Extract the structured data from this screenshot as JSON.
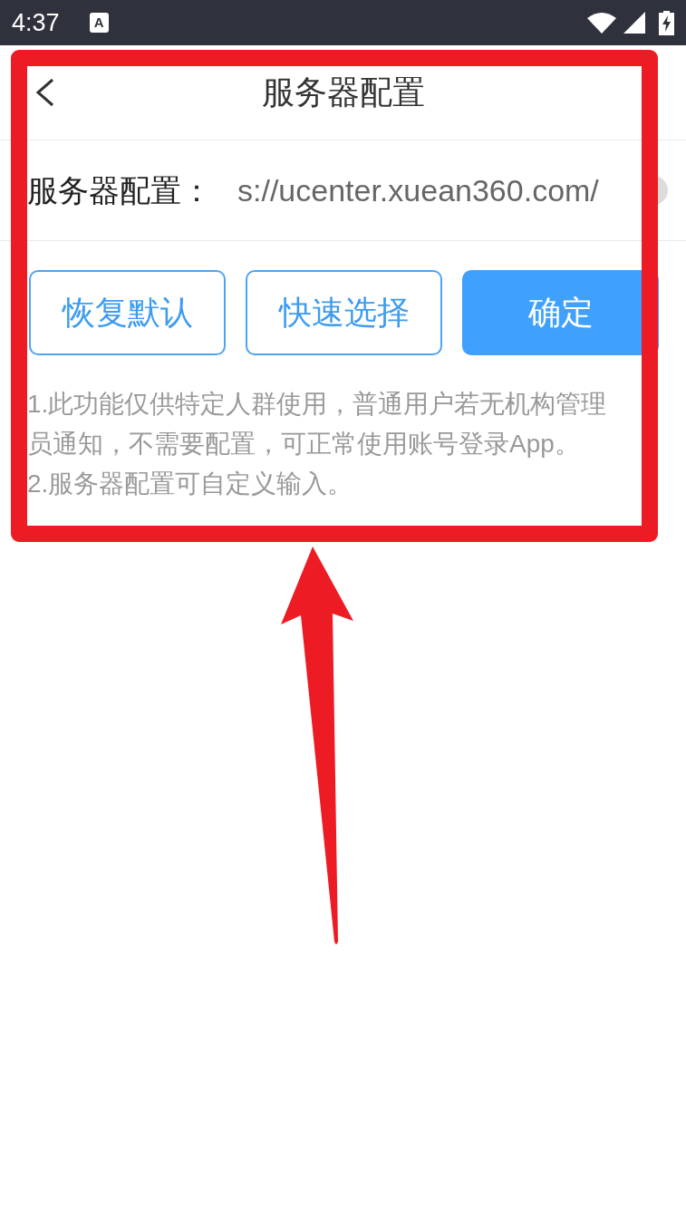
{
  "status_bar": {
    "time": "4:37",
    "input_method": "A"
  },
  "header": {
    "title": "服务器配置"
  },
  "server_field": {
    "label": "服务器配置：",
    "value": "s://ucenter.xuean360.com/"
  },
  "buttons": [
    {
      "label": "恢复默认",
      "kind": "outline"
    },
    {
      "label": "快速选择",
      "kind": "outline"
    },
    {
      "label": "确定",
      "kind": "primary"
    }
  ],
  "notes": [
    "1.此功能仅供特定人群使用，普通用户若无机构管理员通知，不需要配置，可正常使用账号登录App。",
    "2.服务器配置可自定义输入。"
  ]
}
